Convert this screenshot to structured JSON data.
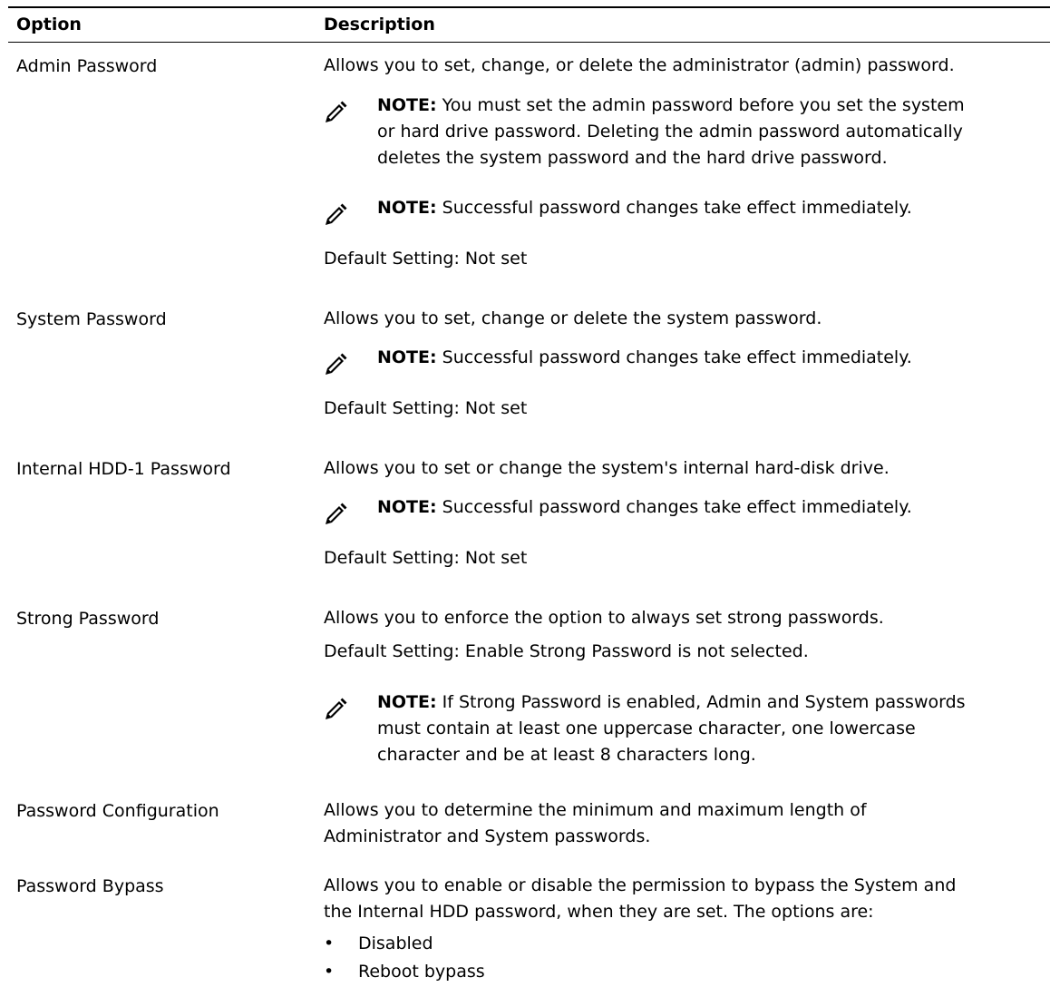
{
  "header": {
    "option": "Option",
    "description": "Description"
  },
  "note_label": "NOTE:",
  "rows": [
    {
      "option": "Admin Password",
      "desc": "Allows you to set, change, or delete the administrator (admin) password.",
      "note1": [
        "You must set the admin password before you set the system",
        "or hard drive password. Deleting the admin password automatically",
        "deletes the system password and the hard drive password."
      ],
      "note2": "Successful password changes take effect immediately.",
      "default": "Default Setting: Not set"
    },
    {
      "option": "System Password",
      "desc": "Allows you to set, change or delete the system password.",
      "note": "Successful password changes take effect immediately.",
      "default": "Default Setting: Not set"
    },
    {
      "option": "Internal HDD-1 Password",
      "desc": "Allows you to set or change the system's internal hard-disk drive.",
      "note": "Successful password changes take effect immediately.",
      "default": "Default Setting: Not set"
    },
    {
      "option": "Strong Password",
      "desc": "Allows you to enforce the option to always set strong passwords.",
      "default": "Default Setting: Enable Strong Password is not selected.",
      "note": [
        "If Strong Password is enabled, Admin and System passwords",
        "must contain at least one uppercase character, one lowercase",
        "character and be at least 8 characters long."
      ]
    },
    {
      "option": "Password Configuration",
      "desc": [
        "Allows you to determine the minimum and maximum length of",
        "Administrator and System passwords."
      ]
    },
    {
      "option": "Password Bypass",
      "desc": [
        "Allows you to enable or disable the permission to bypass the System and",
        "the Internal HDD password, when they are set. The options are:"
      ],
      "bullets": [
        "Disabled",
        "Reboot bypass"
      ]
    }
  ]
}
